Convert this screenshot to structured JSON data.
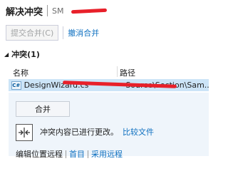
{
  "header": {
    "title": "解决冲突",
    "subtitle": "SM"
  },
  "toolbar": {
    "commit_merge_label": "提交合并(C)",
    "abort_merge_label": "撤消合并"
  },
  "conflicts": {
    "section_label": "冲突(1)",
    "columns": [
      "名称",
      "路径"
    ],
    "rows": [
      {
        "icon": "C#",
        "name": "DesignWizard.cs",
        "path": "Source\\Section\\Sam..."
      }
    ]
  },
  "detail": {
    "merge_button_label": "合并",
    "message": "冲突内容已进行更改。",
    "compare_link": "比较文件",
    "bottom_items": [
      "编辑位置",
      "远程",
      "首目",
      "采用远程"
    ]
  },
  "colors": {
    "accent": "#0e70c0",
    "selection": "#cce4f7",
    "detail_bg": "#eff5fb",
    "redaction": "#e8202a"
  }
}
